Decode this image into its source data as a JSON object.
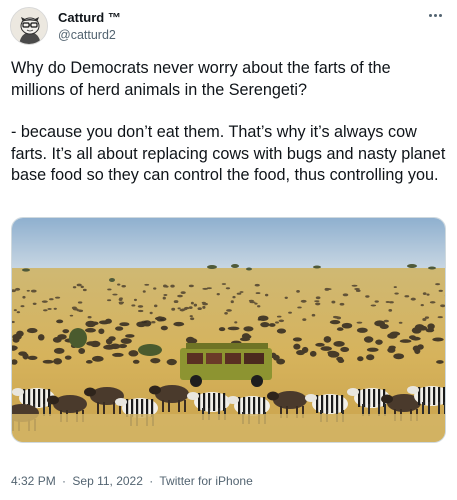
{
  "author": {
    "display_name": "Catturd ™",
    "handle": "@catturd2",
    "avatar_icon": "cat-avatar-icon"
  },
  "more_icon": "more-horizontal-icon",
  "tweet": {
    "paragraphs": [
      "Why do Democrats never worry about the farts of the millions of herd animals in the Serengeti?",
      "- because you don’t eat them. That’s why it’s always cow farts. It’s all about replacing cows with bugs and nasty planet base food so they can control the food, thus controlling you."
    ]
  },
  "media": {
    "description_icon": "savanna-photo"
  },
  "meta": {
    "time": "4:32 PM",
    "separator": "·",
    "date": "Sep 11, 2022",
    "source": "Twitter for iPhone"
  },
  "colors": {
    "text": "#0f1419",
    "secondary": "#536471",
    "sky": "#a9c1d6",
    "grass": "#d9b761"
  }
}
